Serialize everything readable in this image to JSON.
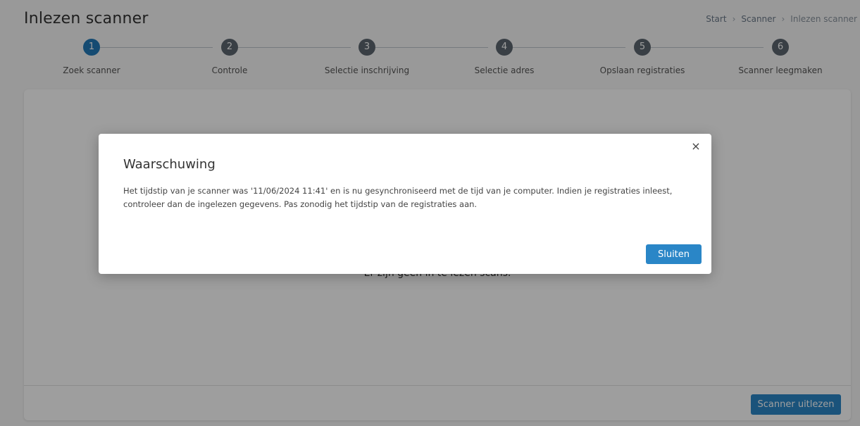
{
  "header": {
    "title": "Inlezen scanner",
    "breadcrumb": [
      "Start",
      "Scanner",
      "Inlezen scanner"
    ]
  },
  "stepper": {
    "active_step": 1,
    "steps": [
      {
        "number": "1",
        "label": "Zoek scanner"
      },
      {
        "number": "2",
        "label": "Controle"
      },
      {
        "number": "3",
        "label": "Selectie inschrijving"
      },
      {
        "number": "4",
        "label": "Selectie adres"
      },
      {
        "number": "5",
        "label": "Opslaan registraties"
      },
      {
        "number": "6",
        "label": "Scanner leegmaken"
      }
    ]
  },
  "content": {
    "empty_message": "Er zijn geen in te lezen scans.",
    "read_button_label": "Scanner uitlezen"
  },
  "modal": {
    "title": "Waarschuwing",
    "message": "Het tijdstip van je scanner was '11/06/2024 11:41' en is nu gesynchroniseerd met de tijd van je computer. Indien je registraties inleest, controleer dan de ingelezen gegevens. Pas zonodig het tijdstip van de registraties aan.",
    "close_icon": "close-icon",
    "close_glyph": "×",
    "button_label": "Sluiten"
  },
  "colors": {
    "primary": "#2a86c7",
    "active_step": "#2379b8",
    "inactive_step": "#5c6770"
  }
}
